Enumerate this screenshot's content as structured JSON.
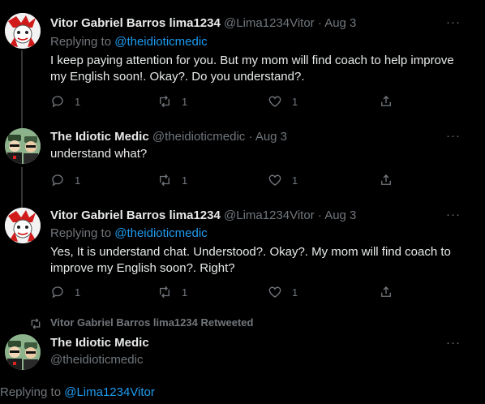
{
  "tweets": [
    {
      "name": "Vitor Gabriel Barros lima1234",
      "handle": "@Lima1234Vitor",
      "dot": "·",
      "date": "Aug 3",
      "more": "···",
      "replying_prefix": "Replying to ",
      "replying_to": "@theidioticmedic",
      "text_line1": "I keep paying attention for you. But my mom will find coach to help improve",
      "text_line2": "my English soon!. Okay?. Do you understand?.",
      "replies": "1",
      "retweets": "1",
      "likes": "1"
    },
    {
      "name": "The Idiotic Medic",
      "handle": "@theidioticmedic",
      "dot": "·",
      "date": "Aug 3",
      "more": "···",
      "text_line1": "understand what?",
      "replies": "1",
      "retweets": "1",
      "likes": "1"
    },
    {
      "name": "Vitor Gabriel Barros lima1234",
      "handle": "@Lima1234Vitor",
      "dot": "·",
      "date": "Aug 3",
      "more": "···",
      "replying_prefix": "Replying to ",
      "replying_to": "@theidioticmedic",
      "text_line1": "Yes, It is understand chat. Understood?. Okay?. My mom will find coach to",
      "text_line2": "improve my English soon?. Right?",
      "replies": "1",
      "retweets": "1",
      "likes": "1"
    }
  ],
  "retweeted_notice": "Vitor Gabriel Barros lima1234 Retweeted",
  "main_tweet": {
    "name": "The Idiotic Medic",
    "handle": "@theidioticmedic",
    "more": "···",
    "replying_prefix": "Replying to ",
    "replying_to": "@Lima1234Vitor"
  },
  "colors": {
    "background": "#000000",
    "text": "#e7e9ea",
    "muted": "#71767b",
    "link": "#1d9bf0"
  }
}
